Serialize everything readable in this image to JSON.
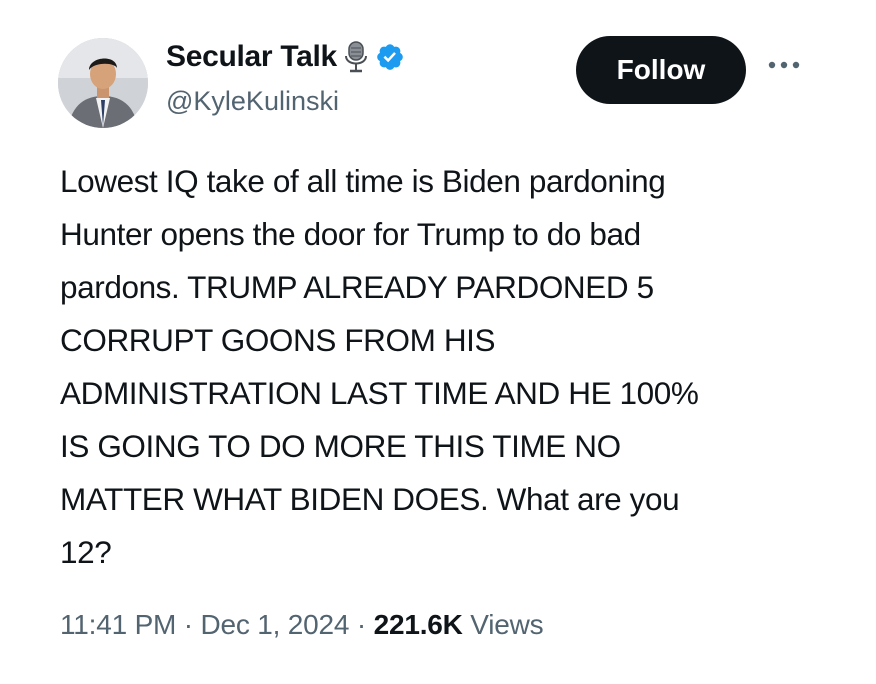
{
  "user": {
    "display_name": "Secular Talk",
    "handle": "@KyleKulinski",
    "badge_icon": "microphone-icon",
    "verified_icon": "verified-badge-icon",
    "verified_color": "#1d9bf0"
  },
  "actions": {
    "follow_label": "Follow",
    "more_icon": "more-options-icon"
  },
  "tweet": {
    "text": "Lowest IQ take of all time is Biden pardoning\nHunter opens the door for Trump to do bad\npardons. TRUMP ALREADY PARDONED 5\nCORRUPT GOONS FROM HIS\nADMINISTRATION LAST TIME AND HE 100%\nIS GOING TO DO MORE THIS TIME NO\nMATTER WHAT BIDEN DOES. What are you\n12?"
  },
  "meta": {
    "time": "11:41 PM",
    "separator": "·",
    "date": "Dec 1, 2024",
    "views_count": "221.6K",
    "views_label": "Views"
  },
  "colors": {
    "text": "#0f1419",
    "secondary": "#536471",
    "button_bg": "#0f1419",
    "background": "#ffffff"
  }
}
